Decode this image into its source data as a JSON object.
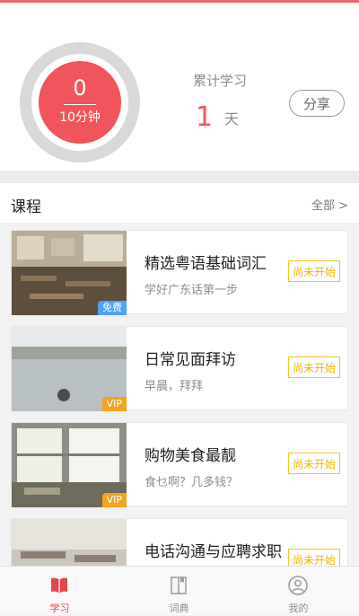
{
  "stats": {
    "today_minutes": "0",
    "goal": "10分钟",
    "total_label": "累计学习",
    "total_days": "1",
    "days_unit": "天",
    "share_label": "分享"
  },
  "courses": {
    "title": "课程",
    "all_label": "全部 >",
    "items": [
      {
        "title": "精选粤语基础词汇",
        "subtitle": "学好广东话第一步",
        "badge": "免费",
        "status": "尚未开始"
      },
      {
        "title": "日常见面拜访",
        "subtitle": "早晨，拜拜",
        "badge": "VIP",
        "status": "尚未开始"
      },
      {
        "title": "购物美食最靓",
        "subtitle": "食乜啊？几多钱？",
        "badge": "VIP",
        "status": "尚未开始"
      },
      {
        "title": "电话沟通与应聘求职",
        "subtitle": "",
        "badge": "",
        "status": "尚未开始"
      }
    ]
  },
  "tabbar": {
    "tabs": [
      {
        "label": "学习",
        "icon": "book-icon",
        "active": true
      },
      {
        "label": "词典",
        "icon": "dictionary-icon",
        "active": false
      },
      {
        "label": "我的",
        "icon": "user-icon",
        "active": false
      }
    ]
  },
  "colors": {
    "accent": "#f1545a",
    "status_border": "#f5c518",
    "free_badge": "#4aa3ff",
    "vip_badge": "#f3a221"
  }
}
